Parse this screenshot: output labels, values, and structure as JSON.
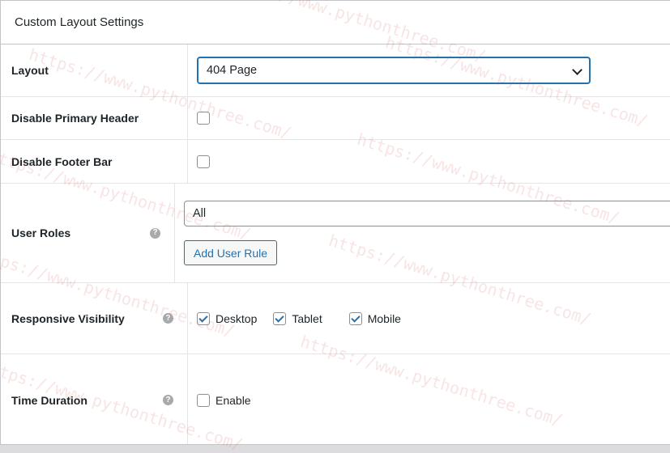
{
  "panel": {
    "title": "Custom Layout Settings"
  },
  "layout": {
    "label": "Layout",
    "selected": "404 Page"
  },
  "disable_primary_header": {
    "label": "Disable Primary Header",
    "checked": false
  },
  "disable_footer_bar": {
    "label": "Disable Footer Bar",
    "checked": false
  },
  "user_roles": {
    "label": "User Roles",
    "value": "All",
    "add_button": "Add User Rule",
    "help_icon": "question-mark-icon"
  },
  "responsive_visibility": {
    "label": "Responsive Visibility",
    "help_icon": "question-mark-icon",
    "options": [
      {
        "label": "Desktop",
        "checked": true
      },
      {
        "label": "Tablet",
        "checked": true
      },
      {
        "label": "Mobile",
        "checked": true
      }
    ]
  },
  "time_duration": {
    "label": "Time Duration",
    "enable_label": "Enable",
    "checked": false,
    "help_icon": "question-mark-icon"
  },
  "watermark": "https://www.pythonthree.com/",
  "colors": {
    "accent": "#2271b1",
    "border": "#c3c4c7",
    "help_icon": "#a7aaad"
  }
}
